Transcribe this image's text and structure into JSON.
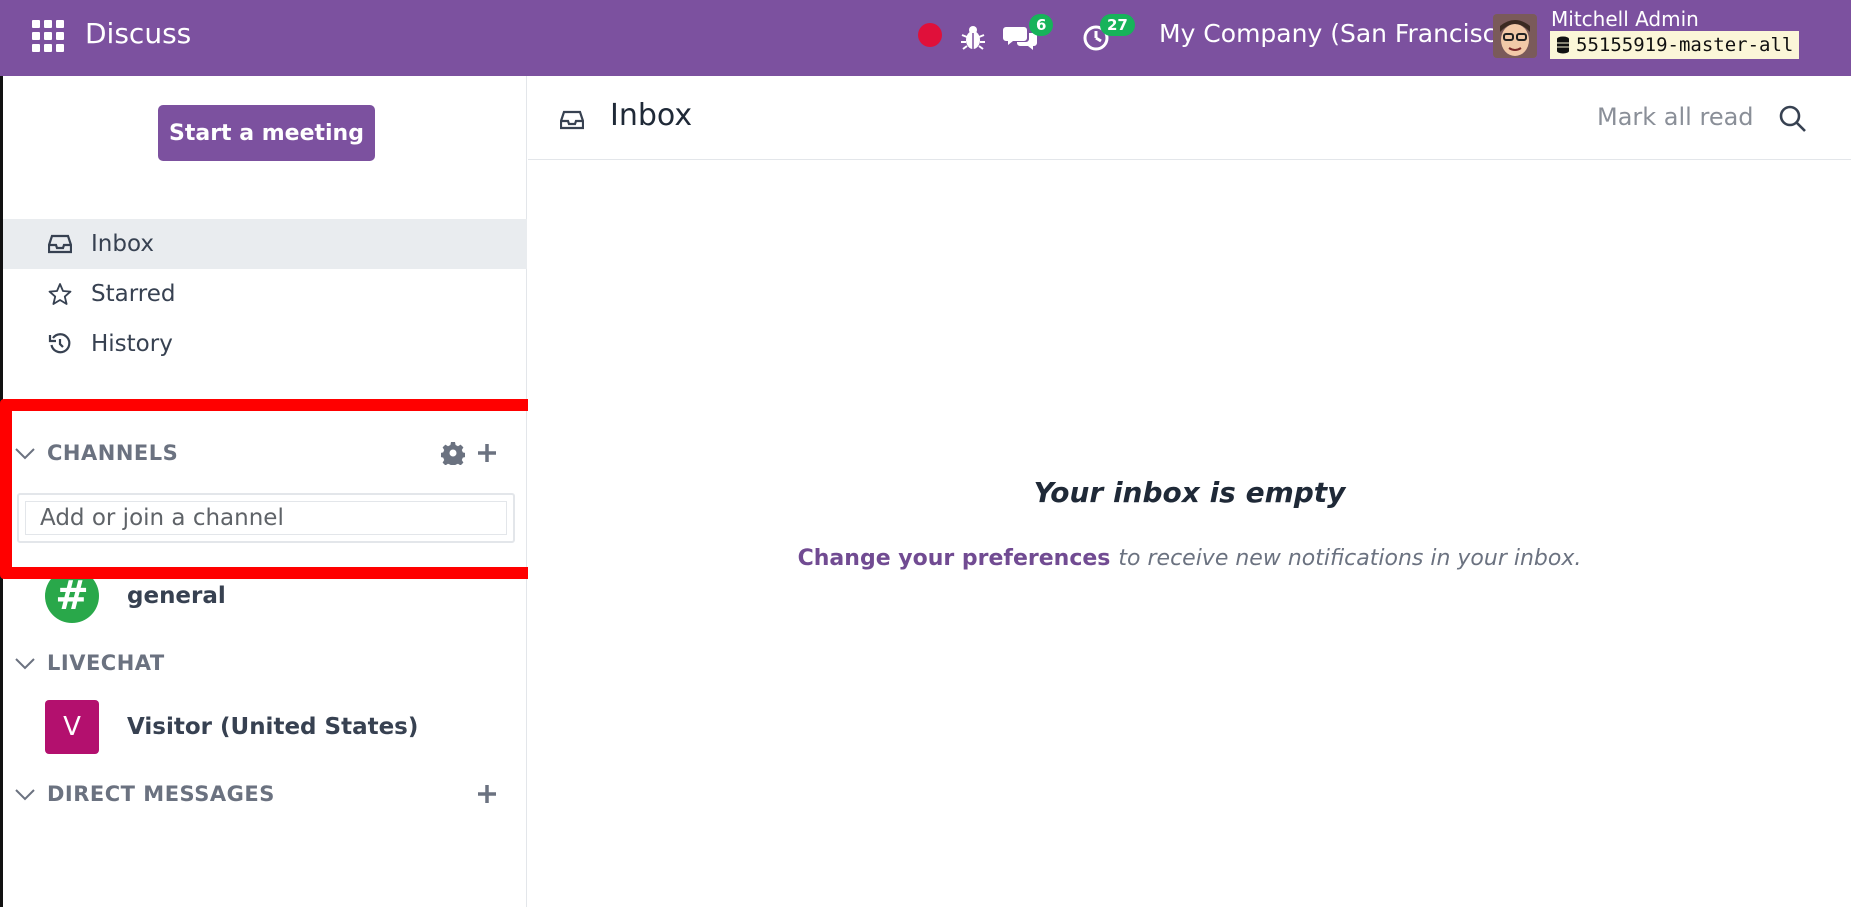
{
  "navbar": {
    "app_name": "Discuss",
    "chat_count": "6",
    "activity_count": "27",
    "company": "My Company (San Francisco)",
    "user_name": "Mitchell Admin",
    "database": "55155919-master-all",
    "bg_color": "#7c519f"
  },
  "sidebar": {
    "start_meeting": "Start a meeting",
    "menu": [
      {
        "label": "Inbox",
        "icon": "inbox-icon"
      },
      {
        "label": "Starred",
        "icon": "star-icon"
      },
      {
        "label": "History",
        "icon": "history-icon"
      }
    ],
    "channels": {
      "heading": "CHANNELS",
      "input_placeholder": "Add or join a channel",
      "items": [
        {
          "label": "general",
          "avatar": "#"
        }
      ]
    },
    "livechat": {
      "heading": "LIVECHAT",
      "items": [
        {
          "label": "Visitor (United States)",
          "avatar": "V"
        }
      ]
    },
    "direct_messages": {
      "heading": "DIRECT MESSAGES"
    }
  },
  "main": {
    "title": "Inbox",
    "mark_all_read": "Mark all read",
    "empty_title": "Your inbox is empty",
    "preferences_link": "Change your preferences",
    "empty_rest": "to receive new notifications in your inbox."
  }
}
